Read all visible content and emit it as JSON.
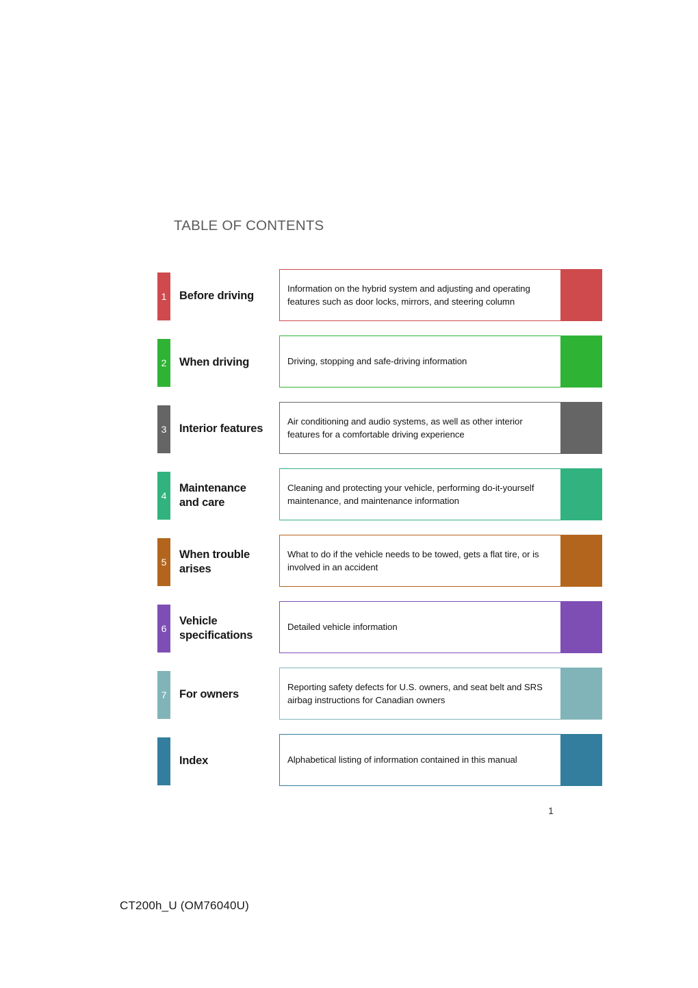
{
  "document": {
    "heading": "TABLE OF CONTENTS",
    "page_number": "1",
    "footer_code": "CT200h_U (OM76040U)"
  },
  "sections": [
    {
      "number": "1",
      "title_line1": "Before driving",
      "title_line2": "",
      "description": "Information on the hybrid system and adjusting and operating features such as door locks, mirrors, and steering column",
      "color": "#ce4a4c"
    },
    {
      "number": "2",
      "title_line1": "When driving",
      "title_line2": "",
      "description": "Driving, stopping and safe-driving information",
      "color": "#2fb335"
    },
    {
      "number": "3",
      "title_line1": "Interior features",
      "title_line2": "",
      "description": "Air conditioning and audio systems, as well as other interior features for a comfortable driving experience",
      "color": "#656565"
    },
    {
      "number": "4",
      "title_line1": "Maintenance",
      "title_line2": "and care",
      "description": "Cleaning and protecting your vehicle, performing do-it-yourself maintenance, and maintenance information",
      "color": "#31b27f"
    },
    {
      "number": "5",
      "title_line1": "When trouble",
      "title_line2": "arises",
      "description": "What to do if the vehicle needs to be towed, gets a flat tire, or is involved in an accident",
      "color": "#b3651d"
    },
    {
      "number": "6",
      "title_line1": "Vehicle",
      "title_line2": "specifications",
      "description": "Detailed vehicle information",
      "color": "#7f4eb5"
    },
    {
      "number": "7",
      "title_line1": "For owners",
      "title_line2": "",
      "description": "Reporting safety defects for U.S. owners, and seat belt and SRS airbag instructions for Canadian owners",
      "color": "#81b4b8"
    },
    {
      "number": "",
      "title_line1": "Index",
      "title_line2": "",
      "description": "Alphabetical listing of information contained in this manual",
      "color": "#337e9e"
    }
  ]
}
